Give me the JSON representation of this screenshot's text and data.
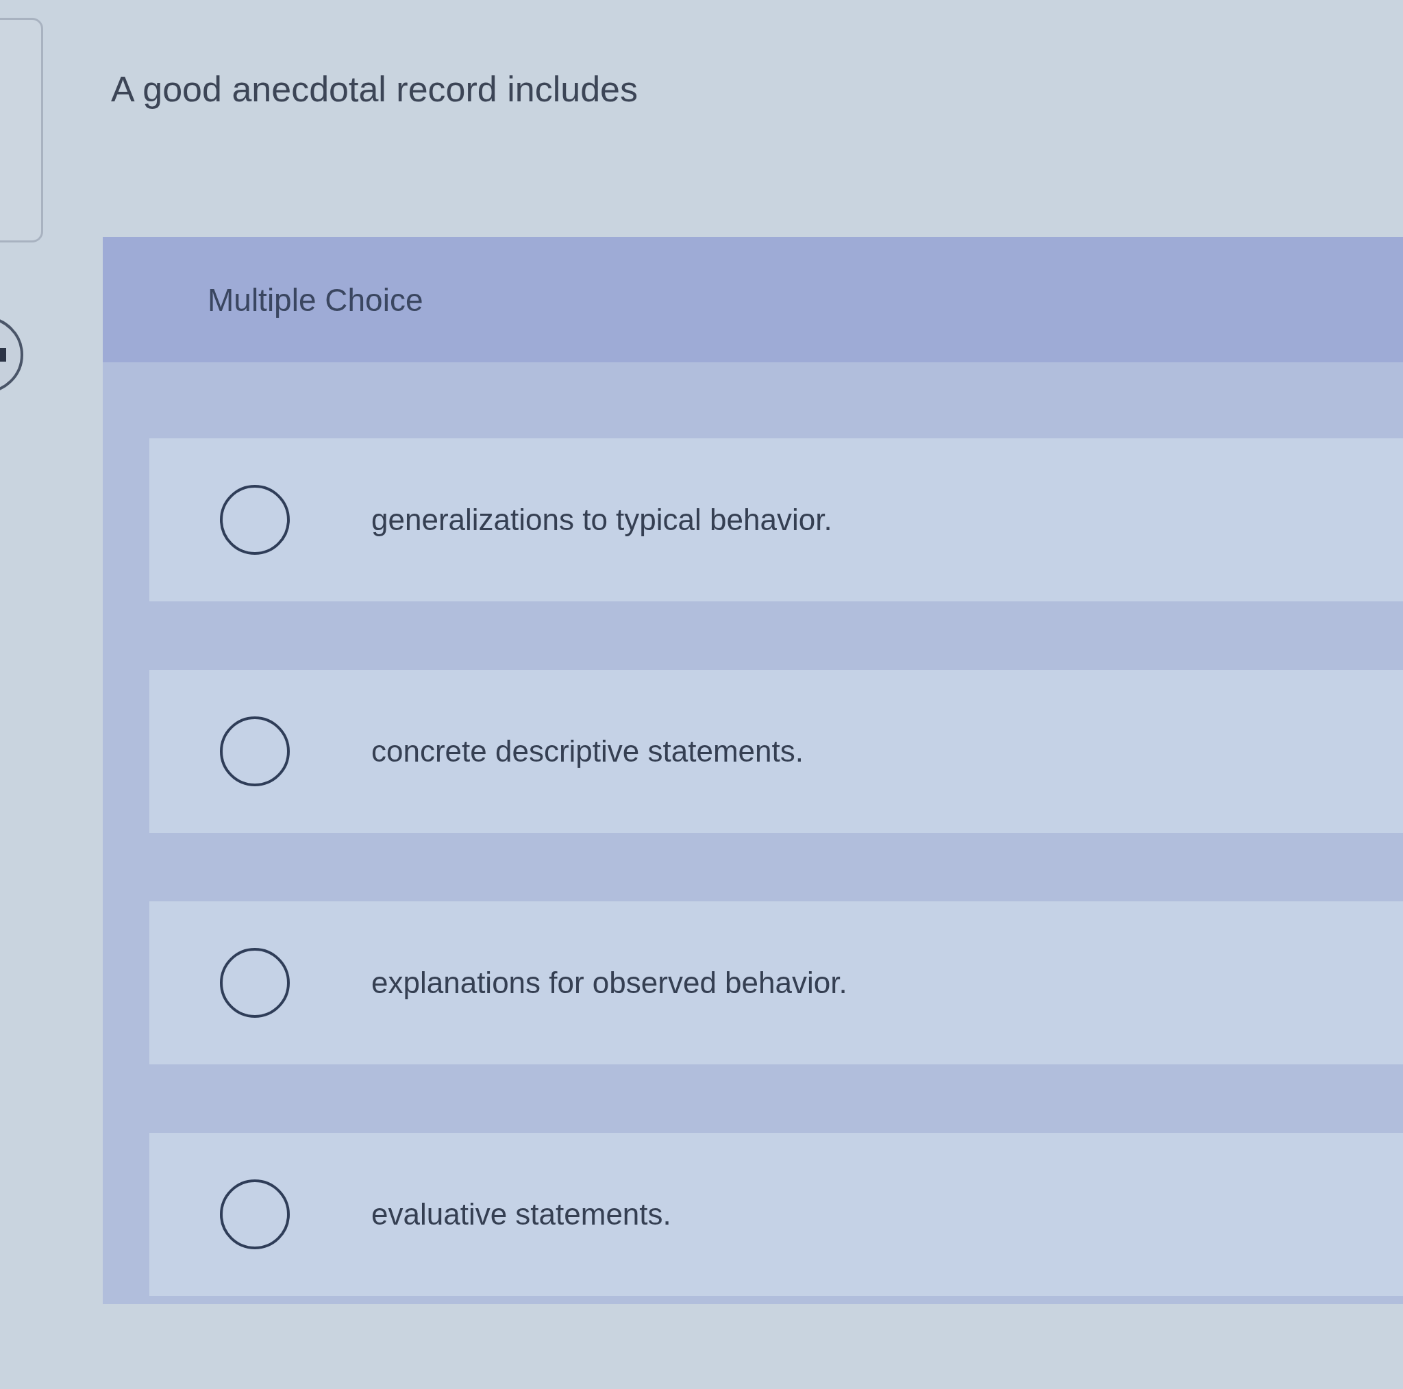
{
  "question": {
    "text": "A good anecdotal record includes"
  },
  "answer_panel": {
    "heading": "Multiple Choice",
    "options": [
      {
        "text": "generalizations to typical behavior.",
        "selected": false
      },
      {
        "text": "concrete descriptive statements.",
        "selected": false
      },
      {
        "text": "explanations for observed behavior.",
        "selected": false
      },
      {
        "text": "evaluative statements.",
        "selected": false
      }
    ]
  }
}
